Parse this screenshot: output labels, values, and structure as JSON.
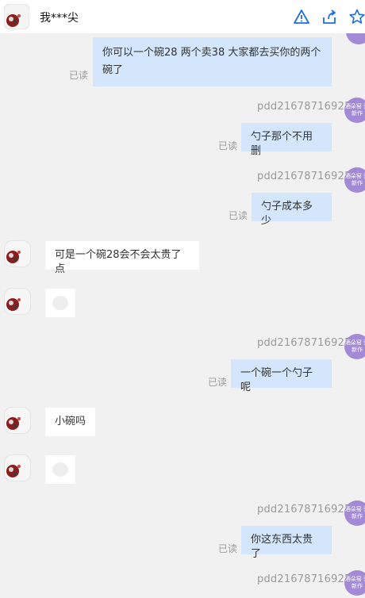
{
  "header": {
    "title": "我***尖",
    "icons": [
      "warning-icon",
      "share-icon",
      "star-icon"
    ],
    "accent": "#1e6fd9"
  },
  "shop": {
    "username": "pdd21678716925",
    "avatar_text": "酒朵窑 瓷新作",
    "avatar_color": "#a48ad6"
  },
  "read_label": "已读",
  "messages": [
    {
      "from": "me",
      "text": "你可以一个碗28 两个卖38 大家都去买你的两个碗了"
    },
    {
      "from": "me",
      "text": "勺子那个不用删"
    },
    {
      "from": "me",
      "text": "勺子成本多少"
    },
    {
      "from": "them",
      "text": "可是一个碗28会不会太贵了点"
    },
    {
      "from": "them",
      "type": "image",
      "text": ""
    },
    {
      "from": "me",
      "text": "一个碗一个勺子呢"
    },
    {
      "from": "them",
      "text": "小碗吗"
    },
    {
      "from": "them",
      "type": "image",
      "text": ""
    },
    {
      "from": "me",
      "text": "你这东西太贵了"
    }
  ],
  "colors": {
    "my_bubble": "#d3e6fb",
    "their_bubble": "#ffffff",
    "background": "#f1f1f1"
  }
}
